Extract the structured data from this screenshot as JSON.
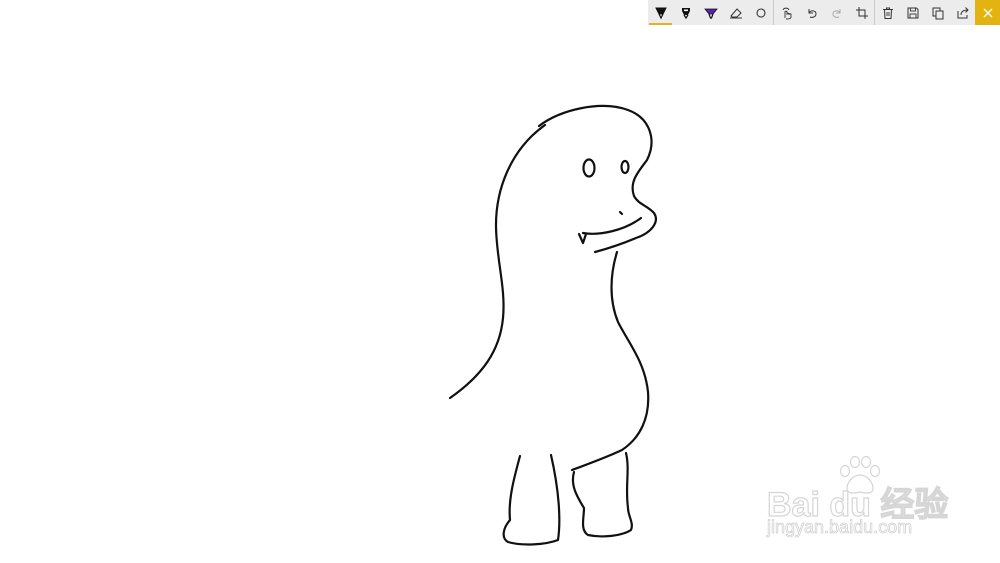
{
  "toolbar": {
    "tools": [
      {
        "name": "ballpoint-pen",
        "color": "#000000",
        "active": true
      },
      {
        "name": "pencil",
        "color": "#000000",
        "active": false
      },
      {
        "name": "highlighter",
        "color": "#5b21b6",
        "active": false
      },
      {
        "name": "eraser",
        "active": false
      },
      {
        "name": "ruler",
        "active": false
      },
      {
        "name": "touch-writing",
        "active": false
      },
      {
        "name": "undo",
        "active": false
      },
      {
        "name": "redo",
        "enabled": false
      },
      {
        "name": "crop",
        "active": false
      },
      {
        "name": "clear-ink",
        "active": false
      },
      {
        "name": "save",
        "active": false
      },
      {
        "name": "copy",
        "active": false
      },
      {
        "name": "share",
        "active": false
      },
      {
        "name": "close",
        "accent": "#e3b312"
      }
    ]
  },
  "canvas": {
    "background": "#ffffff",
    "ink_color": "#111111",
    "drawing": "dinosaur"
  },
  "watermark": {
    "logo_text": "Bai du 经验",
    "url_text": "jingyan.baidu.com"
  }
}
